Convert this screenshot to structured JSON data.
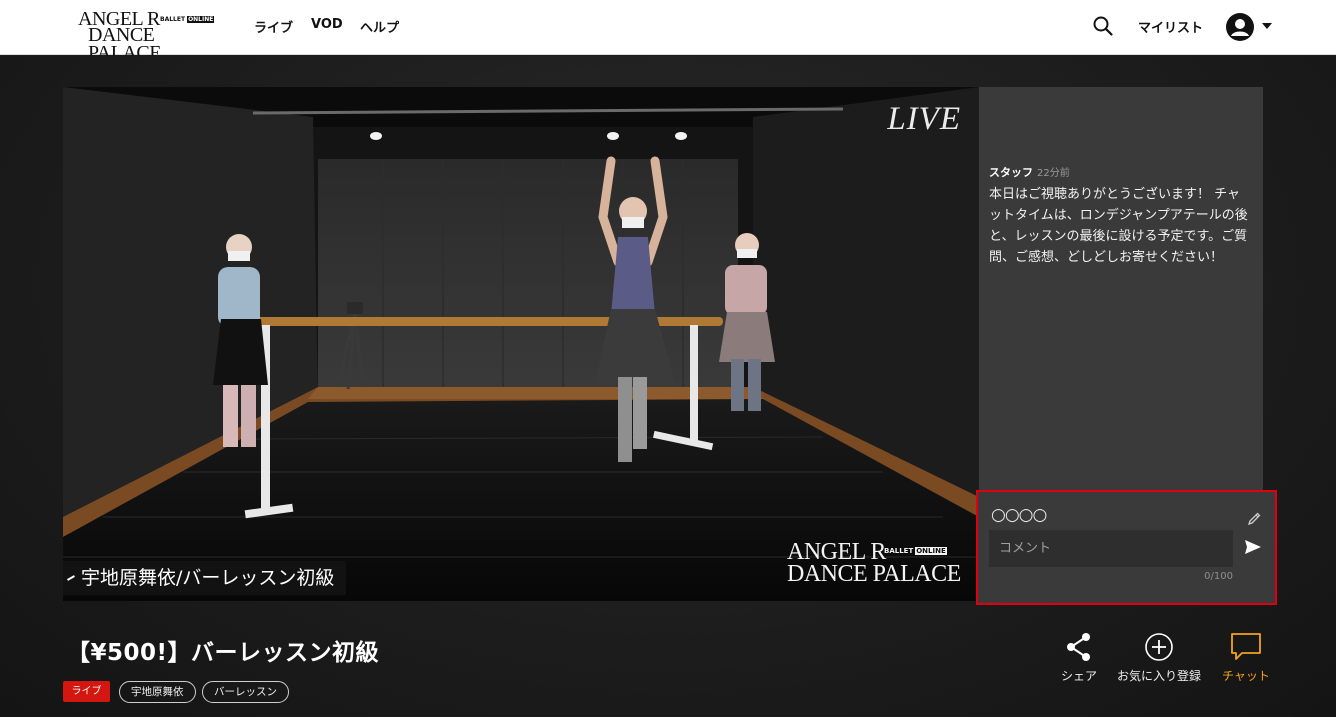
{
  "header": {
    "logo": {
      "line1": "ANGEL R",
      "line2": "DANCE PALACE",
      "tag": "BALLET",
      "tag_inverse": "ONLINE"
    },
    "nav": [
      "ライブ",
      "VOD",
      "ヘルプ"
    ],
    "mylist_label": "マイリスト"
  },
  "video": {
    "live_label": "LIVE",
    "caption": "宇地原舞依/バーレッスン初級",
    "watermark": {
      "line1": "ANGEL R",
      "line2": "DANCE PALACE",
      "tag": "BALLET",
      "tag_inverse": "ONLINE"
    }
  },
  "chat": {
    "author": "スタッフ",
    "time": "22分前",
    "message": "本日はご視聴ありがとうございます！ チャットタイムは、ロンデジャンプアテールの後と、レッスンの最後に設ける予定です。ご質問、ご感想、どしどしお寄せください！",
    "user_name": "○○○○",
    "input_placeholder": "コメント",
    "counter": "0/100"
  },
  "content": {
    "title": "【¥500!】バーレッスン初級",
    "tags": [
      "ライブ",
      "宇地原舞依",
      "バーレッスン"
    ]
  },
  "actions": {
    "share": "シェア",
    "favorite": "お気に入り登録",
    "chat": "チャット"
  },
  "colors": {
    "accent": "#f5a21b",
    "live_tag": "#d3160f",
    "highlight_border": "#e00010"
  }
}
